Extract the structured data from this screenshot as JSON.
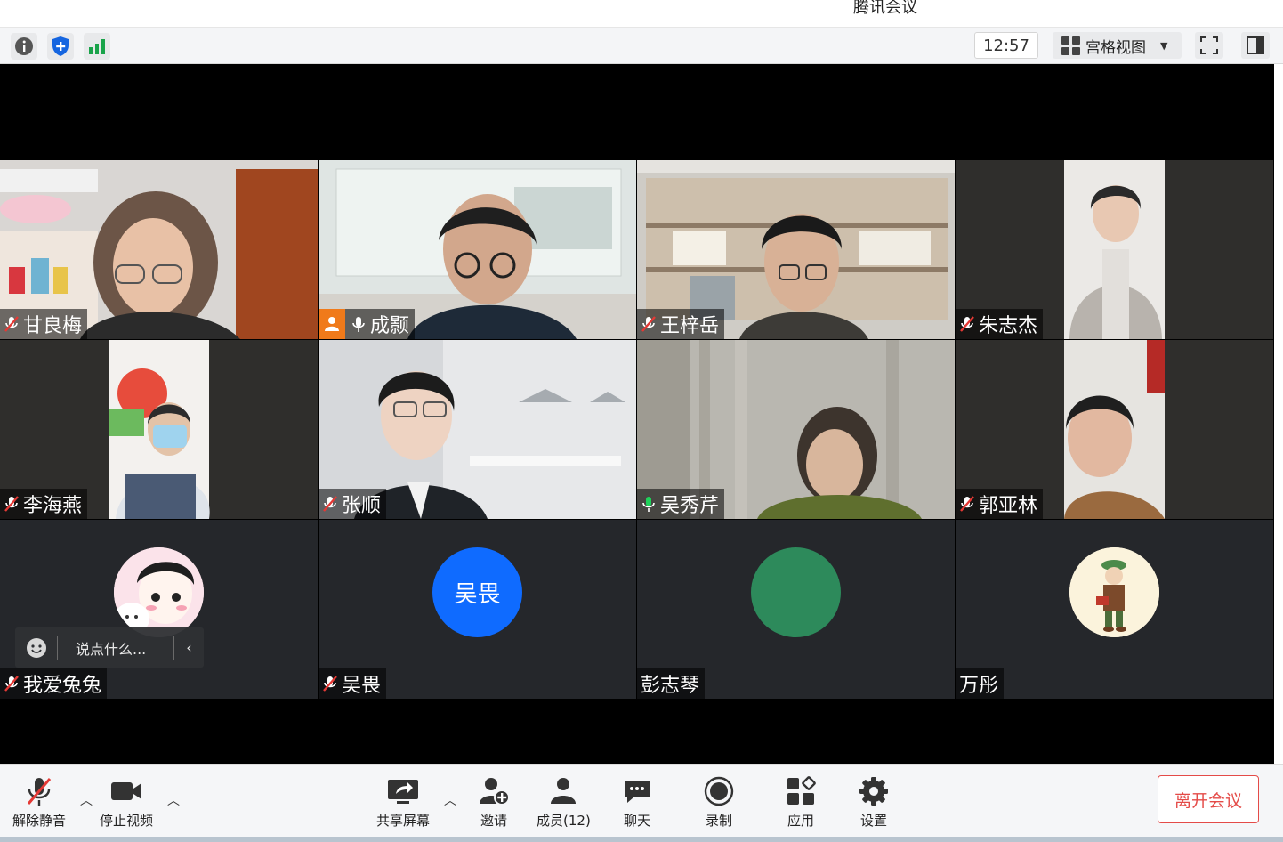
{
  "window": {
    "title": "腾讯会议"
  },
  "topbar": {
    "info_icon": "info-icon",
    "security_icon": "shield-icon",
    "signal_icon": "signal-bars-icon",
    "time": "12:57",
    "view_label": "宫格视图",
    "fullscreen_icon": "fullscreen-icon",
    "sidebar_icon": "sidebar-toggle-icon"
  },
  "participants": [
    {
      "name": "甘良梅",
      "mic": "muted",
      "video": true
    },
    {
      "name": "成颢",
      "mic": "on",
      "video": true,
      "host": true
    },
    {
      "name": "王梓岳",
      "mic": "muted",
      "video": true
    },
    {
      "name": "朱志杰",
      "mic": "muted",
      "video": true
    },
    {
      "name": "李海燕",
      "mic": "muted",
      "video": true
    },
    {
      "name": "张顺",
      "mic": "muted",
      "video": true
    },
    {
      "name": "吴秀芹",
      "mic": "speaking",
      "video": true
    },
    {
      "name": "郭亚林",
      "mic": "muted",
      "video": true
    },
    {
      "name": "我爱兔兔",
      "mic": "muted",
      "video": false,
      "avatar": "cartoon-avatar"
    },
    {
      "name": "吴畏",
      "mic": "muted",
      "video": false,
      "avatar_text": "吴畏",
      "avatar_color": "#0f6bff"
    },
    {
      "name": "彭志琴",
      "mic": "none",
      "video": false,
      "avatar_color": "#2d8a5b"
    },
    {
      "name": "万彤",
      "mic": "none",
      "video": false,
      "avatar": "illustrated-avatar"
    }
  ],
  "chat_popup": {
    "placeholder": "说点什么..."
  },
  "bottombar": {
    "unmute": "解除静音",
    "stop_video": "停止视频",
    "share_screen": "共享屏幕",
    "invite": "邀请",
    "members": "成员(12)",
    "chat": "聊天",
    "record": "录制",
    "apps": "应用",
    "settings": "设置",
    "leave": "离开会议"
  },
  "colors": {
    "leave_red": "#e44b48",
    "host_orange": "#f07a1a",
    "speaking_green": "#1fa64a"
  }
}
